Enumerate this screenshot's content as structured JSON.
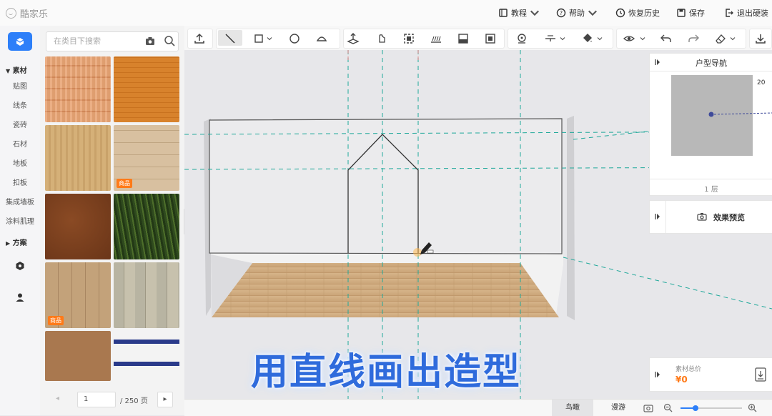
{
  "app": {
    "title": "酷家乐"
  },
  "topbar": {
    "tutorial_label": "教程",
    "help_label": "帮助",
    "restore_label": "恢复历史",
    "save_label": "保存",
    "exit_label": "退出硬装"
  },
  "toolbar": {
    "tools": [
      "upload-icon",
      "line-icon",
      "rectangle-icon",
      "circle-icon",
      "arc-icon",
      "extrude-icon",
      "pointer-icon",
      "frame-icon",
      "hatch-icon",
      "panel-icon",
      "grid-icon",
      "target-icon",
      "align-icon",
      "paint-icon",
      "view-icon",
      "undo-icon",
      "redo-icon",
      "eraser-icon",
      "download-icon"
    ]
  },
  "rail": {
    "category_material": "素材",
    "items": [
      "贴图",
      "线条",
      "瓷砖",
      "石材",
      "地板",
      "扣板",
      "集成墙板",
      "涂料肌理"
    ],
    "category_scheme": "方案"
  },
  "materials": {
    "search_placeholder": "在类目下搜索",
    "badge_label": "商品",
    "swatches": [
      "wood-orange-plank",
      "wood-orange-fine",
      "wood-light-oak",
      "wood-light-plank",
      "wood-dark-walnut",
      "moss-green",
      "wood-light-strip",
      "wood-grey-strip",
      "cork-brown",
      "line-trim"
    ],
    "page_current": "1",
    "page_total": "/ 250 页"
  },
  "nav": {
    "title": "户型导航",
    "scale": "20",
    "floor": "1 层"
  },
  "preview": {
    "label": "效果预览"
  },
  "cost": {
    "label": "素材总价",
    "value": "¥0"
  },
  "bottom": {
    "view_bird": "鸟瞰",
    "view_roam": "漫游"
  },
  "caption": "用直线画出造型",
  "colors": {
    "accent": "#2d7ff9",
    "guide": "#1fa89a",
    "orange": "#ff7a18",
    "caption": "#2f6bdc"
  }
}
